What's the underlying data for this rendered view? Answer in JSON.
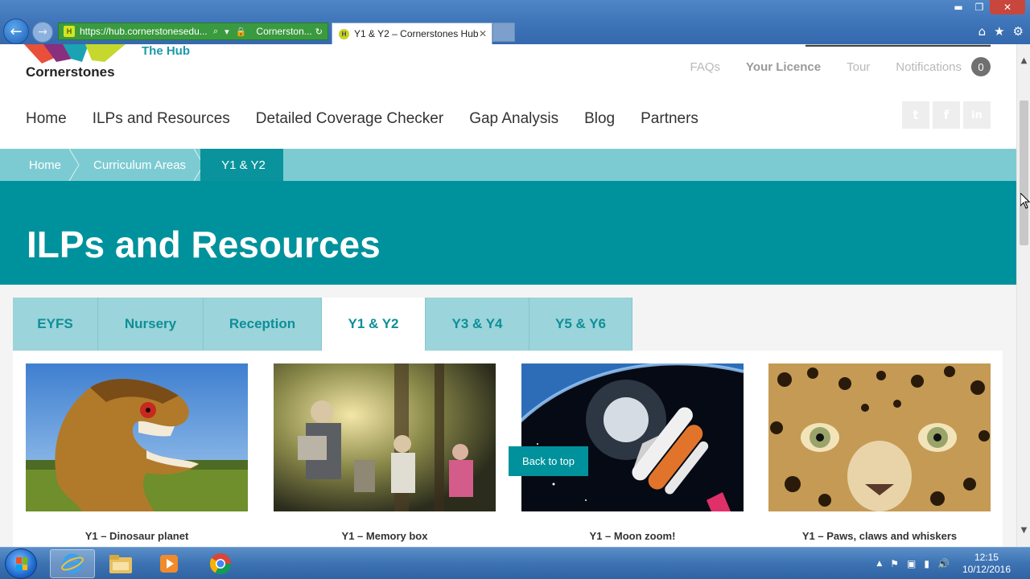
{
  "browser": {
    "address_url": "https://hub.cornerstonesedu...",
    "site_identity": "Cornerston...",
    "tab_title": "Y1 & Y2 – Cornerstones Hub",
    "favicon_letter": "H",
    "win_minimize": "▬",
    "win_restore": "❐",
    "win_close": "✕",
    "back_glyph": "←",
    "forward_glyph": "→",
    "tab_close": "✕",
    "addr_icons": {
      "search": "⌕",
      "dropdown": "▾",
      "lock": "🔒",
      "refresh": "↻"
    },
    "toolbar_icons": {
      "home": "⌂",
      "favorites": "★",
      "settings": "⚙"
    }
  },
  "site": {
    "logo_text": "Cornerstones",
    "hub_label": "The Hub",
    "top_links": {
      "faqs": "FAQs",
      "licence": "Your Licence",
      "tour": "Tour",
      "notifications": "Notifications"
    },
    "notification_count": "0",
    "nav": [
      "Home",
      "ILPs and Resources",
      "Detailed Coverage Checker",
      "Gap Analysis",
      "Blog",
      "Partners"
    ],
    "social": {
      "twitter": "t",
      "facebook": "f",
      "linkedin": "in"
    }
  },
  "breadcrumb": [
    "Home",
    "Curriculum Areas",
    "Y1 & Y2"
  ],
  "hero_title": "ILPs and Resources",
  "year_tabs": [
    {
      "label": "EYFS",
      "active": false
    },
    {
      "label": "Nursery",
      "active": false
    },
    {
      "label": "Reception",
      "active": false
    },
    {
      "label": "Y1 & Y2",
      "active": true
    },
    {
      "label": "Y3 & Y4",
      "active": false
    },
    {
      "label": "Y5 & Y6",
      "active": false
    }
  ],
  "cards": [
    {
      "caption": "Y1 – Dinosaur planet",
      "image": "dinosaur-image"
    },
    {
      "caption": "Y1 – Memory box",
      "image": "memory-box-image"
    },
    {
      "caption": "Y1 – Moon zoom!",
      "image": "space-shuttle-image"
    },
    {
      "caption": "Y1 – Paws, claws and whiskers",
      "image": "leopard-image"
    }
  ],
  "back_to_top": "Back to top",
  "scrollbar": {
    "up": "▲",
    "down": "▼"
  },
  "taskbar": {
    "time": "12:15",
    "date": "10/12/2016",
    "tray_icons": {
      "show_hidden": "▲",
      "action_center": "⚑",
      "power": "▣",
      "network": "▮",
      "volume": "🔊"
    }
  },
  "colors": {
    "teal": "#00929c",
    "breadcrumb": "#7dcbd2",
    "tab_inactive": "#9bd4da"
  }
}
